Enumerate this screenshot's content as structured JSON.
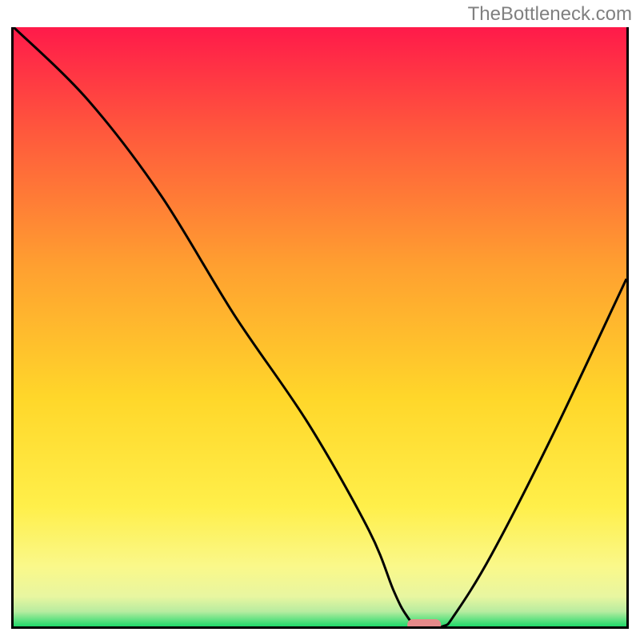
{
  "watermark": "TheBottleneck.com",
  "chart_data": {
    "type": "line",
    "title": "",
    "xlabel": "",
    "ylabel": "",
    "ylim": [
      0,
      100
    ],
    "xlim": [
      0,
      100
    ],
    "gradient": {
      "top_color": "#ff1a4a",
      "mid_colors": [
        "#ff7a3a",
        "#ffd02a",
        "#ffef4a",
        "#faf88a"
      ],
      "bottom_color": "#1fd96a"
    },
    "series": [
      {
        "name": "bottleneck-curve",
        "x": [
          0,
          12,
          24,
          36,
          48,
          58,
          62,
          64,
          66,
          70,
          72,
          78,
          88,
          100
        ],
        "y": [
          100,
          88,
          72,
          52,
          34,
          16,
          6,
          2,
          0,
          0,
          2,
          12,
          32,
          58
        ]
      }
    ],
    "marker": {
      "name": "optimal-range",
      "x_center": 67,
      "y": 0,
      "width_frac": 0.055,
      "color": "#e58a8a"
    }
  }
}
